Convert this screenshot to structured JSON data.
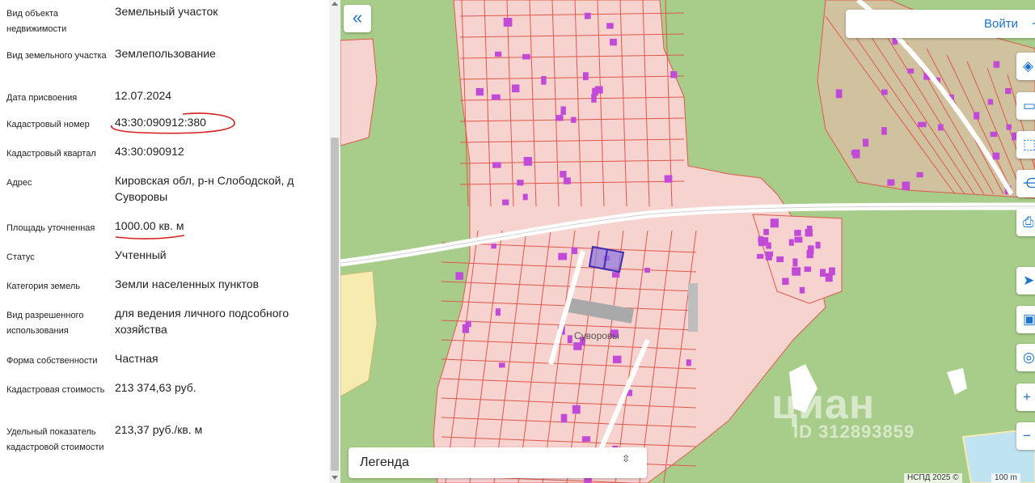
{
  "properties": [
    {
      "label": "Вид объекта недвижимости",
      "value": "Земельный участок"
    },
    {
      "label": "Вид земельного участка",
      "value": "Землепользование"
    },
    {
      "label": "Дата присвоения",
      "value": "12.07.2024"
    },
    {
      "label": "Кадастровый номер",
      "value": "43:30:090912:380"
    },
    {
      "label": "Кадастровый квартал",
      "value": "43:30:090912"
    },
    {
      "label": "Адрес",
      "value": "Кировская обл, р-н Слободской, д Суворовы"
    },
    {
      "label": "Площадь уточненная",
      "value": "1000.00 кв. м"
    },
    {
      "label": "Статус",
      "value": "Учтенный"
    },
    {
      "label": "Категория земель",
      "value": "Земли населенных пунктов"
    },
    {
      "label": "Вид разрешенного использования",
      "value": "для ведения личного подсобного хозяйства"
    },
    {
      "label": "Форма собственности",
      "value": "Частная"
    },
    {
      "label": "Кадастровая стоимость",
      "value": "213 374,63 руб."
    },
    {
      "label": "Удельный показатель кадастровой стоимости",
      "value": "213,37 руб./кв. м"
    }
  ],
  "annotation_color": "#d62020",
  "map": {
    "collapse_icon": "«",
    "login_label": "Войти",
    "login_icon": "⇥",
    "tools": [
      {
        "icon": "layers-icon",
        "glyph": "◈"
      },
      {
        "icon": "ruler-icon",
        "glyph": "▭"
      },
      {
        "icon": "select-area-icon",
        "glyph": "⬚"
      },
      {
        "icon": "share-icon",
        "glyph": "⋲"
      },
      {
        "icon": "print-icon",
        "glyph": "⎙"
      },
      {
        "icon": "location-icon",
        "glyph": "➤"
      },
      {
        "icon": "screen-icon",
        "glyph": "▣"
      },
      {
        "icon": "search-location-icon",
        "glyph": "◎"
      },
      {
        "icon": "zoom-in-icon",
        "glyph": "+"
      },
      {
        "icon": "zoom-out-icon",
        "glyph": "−"
      }
    ],
    "legend_label": "Легенда",
    "legend_icon": "⇳",
    "place_label": "Суворовы",
    "attribution": "НСПД 2025 ©",
    "scale_label": "100 m",
    "watermark_text": "циан",
    "watermark_id": "ID 312893859",
    "colors": {
      "forest": "#a8cd8a",
      "parcel_fill": "#f7d3d0",
      "parcel_stroke": "#e0584a",
      "building": "#c24ad8",
      "selected": "#5a3fd0",
      "road": "#ffffff"
    }
  }
}
